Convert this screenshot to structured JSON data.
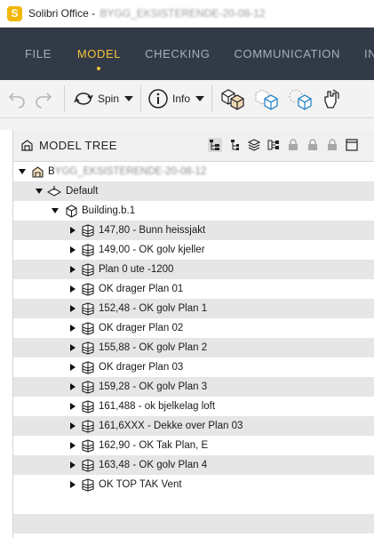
{
  "titlebar": {
    "app_logo": "S",
    "title": "Solibri Office - ",
    "title_redacted": "BYGG_EKSISTERENDE-20-08-12"
  },
  "menu": {
    "items": [
      {
        "label": "FILE",
        "active": false
      },
      {
        "label": "MODEL",
        "active": true
      },
      {
        "label": "CHECKING",
        "active": false
      },
      {
        "label": "COMMUNICATION",
        "active": false
      },
      {
        "label": "INFO",
        "active": false
      }
    ]
  },
  "toolbar": {
    "spin_label": "Spin",
    "info_label": "Info"
  },
  "panel": {
    "title": "MODEL TREE"
  },
  "tree": {
    "root": {
      "prefix": "B",
      "redacted": "YGG_EKSISTERENDE-20-08-12"
    },
    "default_label": "Default",
    "building_label": "Building.b.1",
    "storeys": [
      "147,80 - Bunn heissjakt",
      "149,00 - OK golv kjeller",
      "Plan 0 ute -1200",
      "OK drager Plan 01",
      "152,48 - OK golv Plan 1",
      "OK drager Plan 02",
      "155,88 - OK golv Plan 2",
      "OK drager Plan 03",
      "159,28 - OK golv Plan 3",
      "161,488 - ok bjelkelag loft",
      "161,6XXX - Dekke over Plan 03",
      "162,90 - OK Tak Plan,  E",
      "163,48 - OK golv Plan 4",
      "OK TOP TAK Vent"
    ]
  },
  "colors": {
    "menubar_bg": "#323a47",
    "menu_active": "#f2c23a",
    "menu_inactive": "#a6afbd",
    "logo": "#f2b705",
    "row_alt": "#e6e6e6"
  }
}
